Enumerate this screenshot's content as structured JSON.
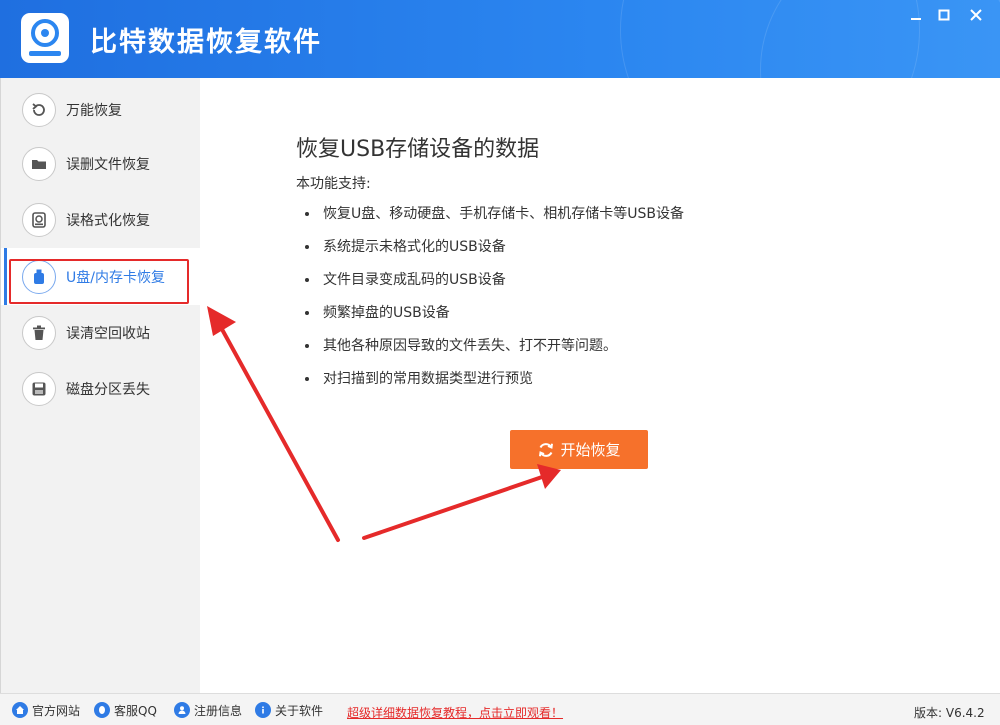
{
  "app": {
    "title": "比特数据恢复软件"
  },
  "window_controls": {
    "minimize": "—",
    "maximize": "☐",
    "close": "✕"
  },
  "sidebar": {
    "items": [
      {
        "label": "万能恢复",
        "icon": "undo-icon"
      },
      {
        "label": "误删文件恢复",
        "icon": "folder-icon"
      },
      {
        "label": "误格式化恢复",
        "icon": "format-disk-icon"
      },
      {
        "label": "U盘/内存卡恢复",
        "icon": "usb-icon",
        "active": true
      },
      {
        "label": "误清空回收站",
        "icon": "trash-icon"
      },
      {
        "label": "磁盘分区丢失",
        "icon": "disk-icon"
      }
    ]
  },
  "main": {
    "title": "恢复USB存储设备的数据",
    "subtitle": "本功能支持:",
    "features": [
      "恢复U盘、移动硬盘、手机存储卡、相机存储卡等USB设备",
      "系统提示未格式化的USB设备",
      "文件目录变成乱码的USB设备",
      "频繁掉盘的USB设备",
      "其他各种原因导致的文件丢失、打不开等问题。",
      "对扫描到的常用数据类型进行预览"
    ],
    "start_button": "开始恢复"
  },
  "footer": {
    "links": [
      {
        "label": "官方网站",
        "icon": "home-icon"
      },
      {
        "label": "客服QQ",
        "icon": "qq-icon"
      },
      {
        "label": "注册信息",
        "icon": "user-icon"
      },
      {
        "label": "关于软件",
        "icon": "info-icon"
      }
    ],
    "promo": "超级详细数据恢复教程，点击立即观看！",
    "version": "版本: V6.4.2"
  },
  "colors": {
    "header": "#2b86f0",
    "accent": "#2f7be5",
    "start_button": "#f6712b",
    "annotation": "#e52a2a"
  }
}
